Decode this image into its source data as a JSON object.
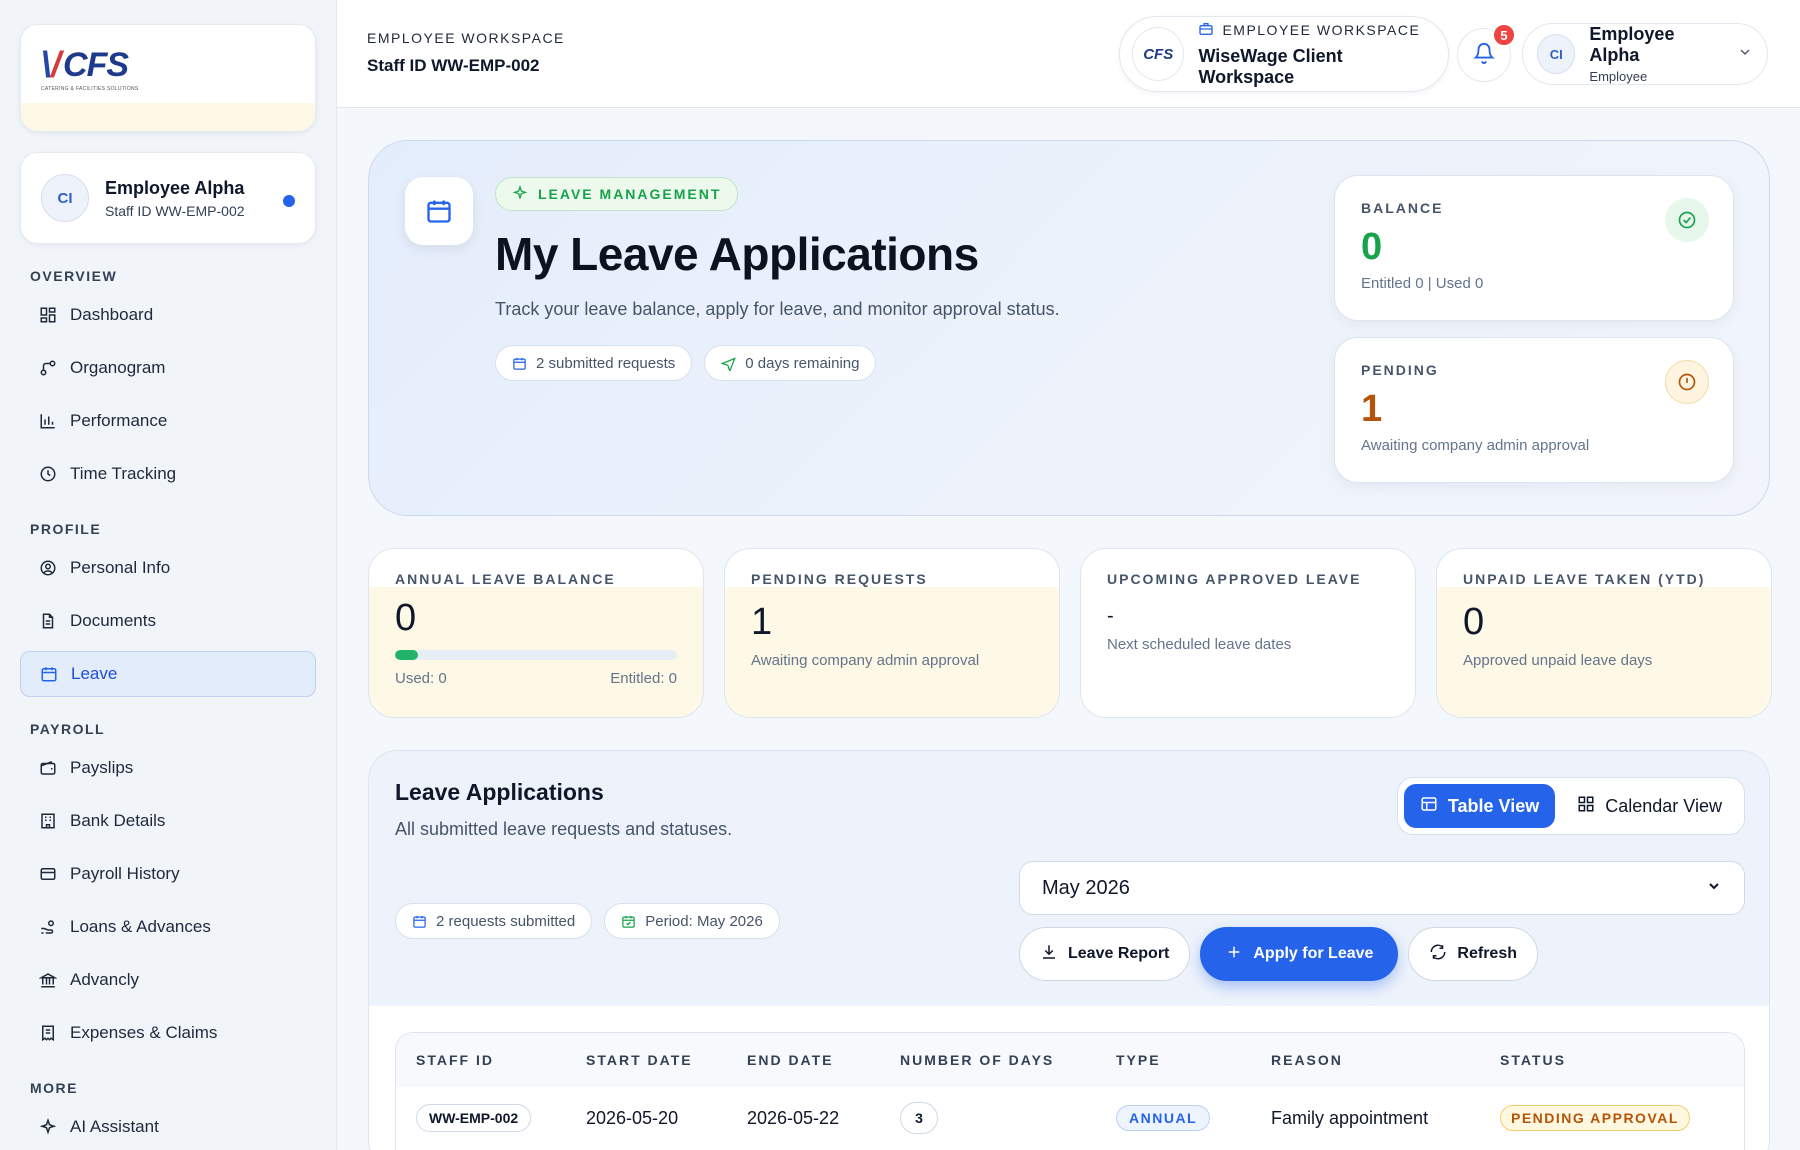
{
  "brand": {
    "logo_text": "CFS",
    "logo_tagline": "CATERING & FACILITIES SOLUTIONS"
  },
  "sidebar": {
    "user": {
      "initials": "CI",
      "name": "Employee Alpha",
      "staff_id": "Staff ID WW-EMP-002"
    },
    "sections": [
      {
        "title": "OVERVIEW",
        "items": [
          {
            "label": "Dashboard",
            "icon": "dashboard-icon"
          },
          {
            "label": "Organogram",
            "icon": "organogram-icon"
          },
          {
            "label": "Performance",
            "icon": "chart-icon"
          },
          {
            "label": "Time Tracking",
            "icon": "clock-icon"
          }
        ]
      },
      {
        "title": "PROFILE",
        "items": [
          {
            "label": "Personal Info",
            "icon": "user-circle-icon"
          },
          {
            "label": "Documents",
            "icon": "document-icon"
          },
          {
            "label": "Leave",
            "icon": "calendar-icon",
            "active": true
          }
        ]
      },
      {
        "title": "PAYROLL",
        "items": [
          {
            "label": "Payslips",
            "icon": "wallet-icon"
          },
          {
            "label": "Bank Details",
            "icon": "building-icon"
          },
          {
            "label": "Payroll History",
            "icon": "card-icon"
          },
          {
            "label": "Loans & Advances",
            "icon": "hand-coins-icon"
          },
          {
            "label": "Advancly",
            "icon": "bank-icon"
          },
          {
            "label": "Expenses & Claims",
            "icon": "receipt-icon"
          }
        ]
      },
      {
        "title": "MORE",
        "items": [
          {
            "label": "AI Assistant",
            "icon": "sparkle-icon"
          }
        ]
      }
    ]
  },
  "topbar": {
    "workspace_label": "EMPLOYEE WORKSPACE",
    "staff_id": "Staff ID WW-EMP-002",
    "client": {
      "label": "EMPLOYEE WORKSPACE",
      "name": "WiseWage Client Workspace",
      "logo_text": "CFS"
    },
    "notifications": "5",
    "profile": {
      "initials": "CI",
      "name": "Employee Alpha",
      "role": "Employee"
    }
  },
  "hero": {
    "tag": "LEAVE MANAGEMENT",
    "title": "My Leave Applications",
    "description": "Track your leave balance, apply for leave, and monitor approval status.",
    "chips": [
      "2 submitted requests",
      "0 days remaining"
    ],
    "balance": {
      "label": "BALANCE",
      "value": "0",
      "note": "Entitled 0 | Used 0",
      "color": "#16a34a"
    },
    "pending": {
      "label": "PENDING",
      "value": "1",
      "note": "Awaiting company admin approval",
      "color": "#b45309"
    }
  },
  "summary": {
    "annual": {
      "label": "ANNUAL LEAVE BALANCE",
      "value": "0",
      "used": "Used: 0",
      "entitled": "Entitled: 0",
      "progress": 0.08
    },
    "pending": {
      "label": "PENDING REQUESTS",
      "value": "1",
      "note": "Awaiting company admin approval"
    },
    "upcoming": {
      "label": "UPCOMING APPROVED LEAVE",
      "value": "-",
      "note": "Next scheduled leave dates"
    },
    "unpaid": {
      "label": "UNPAID LEAVE TAKEN (YTD)",
      "value": "0",
      "note": "Approved unpaid leave days"
    }
  },
  "applications": {
    "title": "Leave Applications",
    "description": "All submitted leave requests and statuses.",
    "views": {
      "table": "Table View",
      "calendar": "Calendar View"
    },
    "chips": [
      "2 requests submitted",
      "Period: May 2026"
    ],
    "month": "May 2026",
    "actions": {
      "report": "Leave Report",
      "apply": "Apply for Leave",
      "refresh": "Refresh"
    },
    "columns": [
      "STAFF ID",
      "START DATE",
      "END DATE",
      "NUMBER OF DAYS",
      "TYPE",
      "REASON",
      "STATUS"
    ],
    "rows": [
      {
        "staff_id": "WW-EMP-002",
        "start": "2026-05-20",
        "end": "2026-05-22",
        "days": "3",
        "type": "ANNUAL",
        "reason": "Family appointment",
        "status": "PENDING APPROVAL"
      }
    ]
  }
}
